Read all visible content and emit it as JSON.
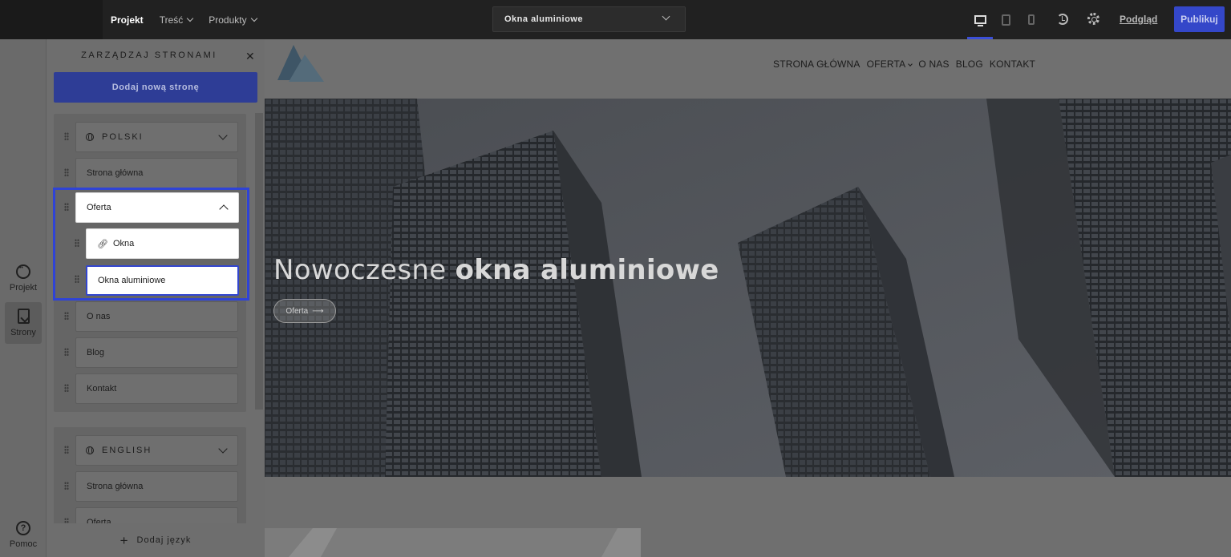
{
  "topbar": {
    "nav": [
      {
        "label": "Projekt",
        "active": true,
        "has_chevron": false
      },
      {
        "label": "Treść",
        "active": false,
        "has_chevron": true
      },
      {
        "label": "Produkty",
        "active": false,
        "has_chevron": true
      }
    ],
    "page_select": {
      "value": "Okna aluminiowe",
      "icon": "chevron-down-icon"
    },
    "devices": [
      {
        "name": "desktop",
        "active": true
      },
      {
        "name": "tablet",
        "active": false
      },
      {
        "name": "mobile",
        "active": false
      }
    ],
    "preview_label": "Podgląd",
    "publish_label": "Publikuj",
    "accent_color": "#3447c9"
  },
  "rail": {
    "items": [
      {
        "label": "Projekt",
        "icon": "palette-icon"
      },
      {
        "label": "Strony",
        "icon": "pages-icon",
        "active": true
      },
      {
        "label": "Pomoc",
        "icon": "help-icon"
      }
    ]
  },
  "panel": {
    "title": "ZARZĄDZAJ STRONAMI",
    "add_page_label": "Dodaj nową stronę",
    "add_language_label": "Dodaj język",
    "groups": [
      {
        "language": "POLSKI",
        "pages": [
          {
            "label": "Strona główna"
          },
          {
            "label": "Oferta",
            "expanded": true,
            "children": [
              {
                "label": "Okna",
                "is_link": true
              },
              {
                "label": "Okna aluminiowe",
                "selected": true
              }
            ]
          },
          {
            "label": "O nas"
          },
          {
            "label": "Blog"
          },
          {
            "label": "Kontakt"
          }
        ]
      },
      {
        "language": "ENGLISH",
        "pages": [
          {
            "label": "Strona główna"
          },
          {
            "label": "Oferta"
          }
        ]
      }
    ]
  },
  "site": {
    "nav": [
      "STRONA GŁÓWNA",
      "OFERTA",
      "O NAS",
      "BLOG",
      "KONTAKT"
    ],
    "hero_title_light": "Nowoczesne ",
    "hero_title_bold": "okna aluminiowe",
    "hero_button": "Oferta",
    "hero_button_arrow": "⟶"
  }
}
